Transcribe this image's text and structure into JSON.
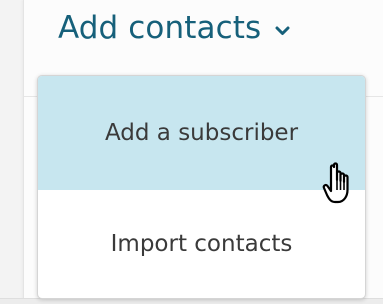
{
  "trigger": {
    "label": "Add contacts",
    "icon": "chevron-down-icon"
  },
  "menu": {
    "items": [
      {
        "label": "Add a subscriber",
        "state": "hovered"
      },
      {
        "label": "Import contacts"
      }
    ]
  },
  "cursor": {
    "icon": "hand-pointer-icon"
  },
  "colors": {
    "trigger_text": "#16607a",
    "hover_background": "#c7e6ef",
    "menu_text": "#3a3a3a"
  }
}
